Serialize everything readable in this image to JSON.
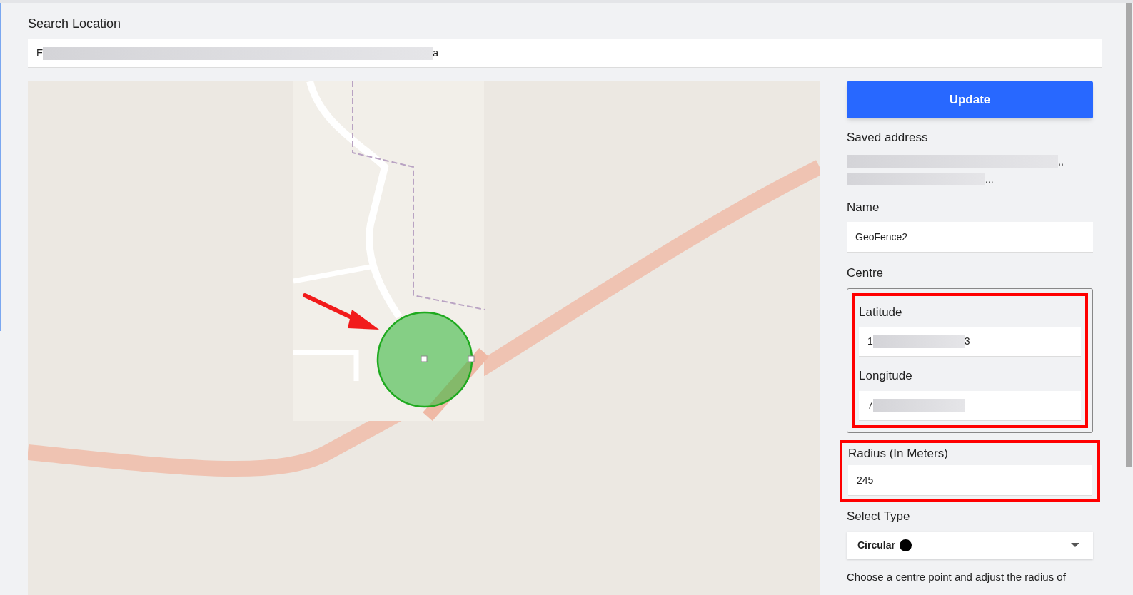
{
  "search": {
    "label": "Search Location",
    "value_start": "E",
    "value_end": "a"
  },
  "update_button": "Update",
  "saved_address": {
    "label": "Saved address",
    "line_1_end": ",,",
    "line_2_end": "..."
  },
  "name": {
    "label": "Name",
    "value": "GeoFence2"
  },
  "centre": {
    "label": "Centre",
    "highlighted": true,
    "latitude": {
      "label": "Latitude",
      "value_start": "1",
      "value_end": "3"
    },
    "longitude": {
      "label": "Longitude",
      "value_start": "7"
    }
  },
  "radius": {
    "label": "Radius (In Meters)",
    "value": "245",
    "highlighted": true
  },
  "select_type": {
    "label": "Select Type",
    "value": "Circular"
  },
  "description": "Choose a centre point and adjust the radius of"
}
